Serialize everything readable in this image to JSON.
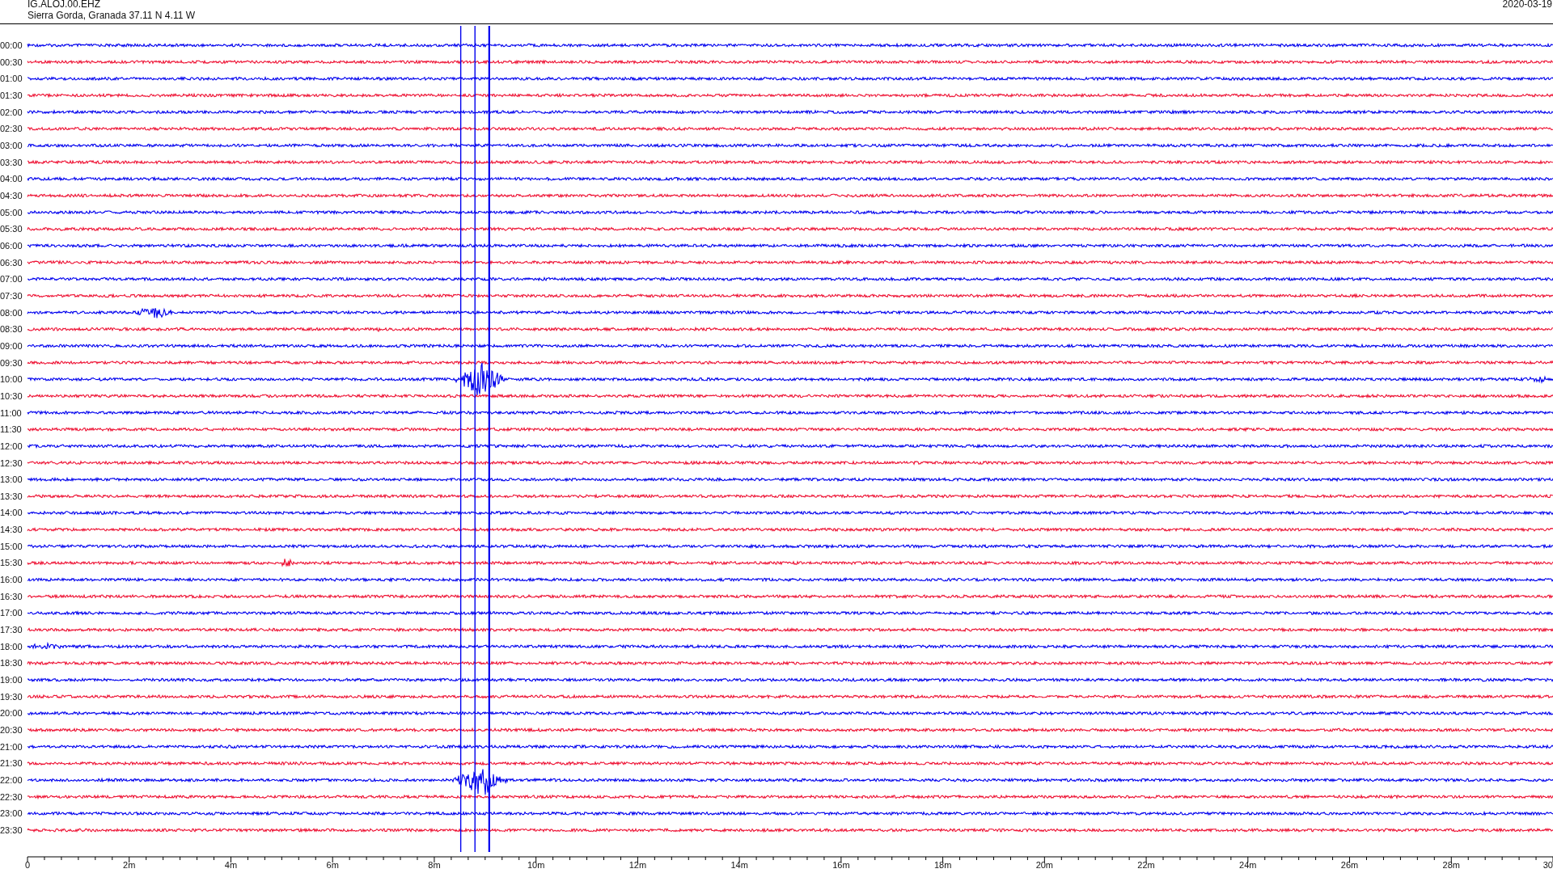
{
  "header": {
    "station": "IG.ALOJ.00.EHZ",
    "location": "Sierra Gorda, Granada  37.11 N 4.11 W",
    "date": "2020-03-19"
  },
  "traces": [
    {
      "time": "00:00",
      "color": "#0000ee"
    },
    {
      "time": "00:30",
      "color": "#ee1133"
    },
    {
      "time": "01:00",
      "color": "#0000ee"
    },
    {
      "time": "01:30",
      "color": "#ee1133"
    },
    {
      "time": "02:00",
      "color": "#0000ee"
    },
    {
      "time": "02:30",
      "color": "#ee1133"
    },
    {
      "time": "03:00",
      "color": "#0000ee"
    },
    {
      "time": "03:30",
      "color": "#ee1133"
    },
    {
      "time": "04:00",
      "color": "#0000ee"
    },
    {
      "time": "04:30",
      "color": "#ee1133"
    },
    {
      "time": "05:00",
      "color": "#0000ee"
    },
    {
      "time": "05:30",
      "color": "#ee1133"
    },
    {
      "time": "06:00",
      "color": "#0000ee"
    },
    {
      "time": "06:30",
      "color": "#ee1133"
    },
    {
      "time": "07:00",
      "color": "#0000ee"
    },
    {
      "time": "07:30",
      "color": "#ee1133"
    },
    {
      "time": "08:00",
      "color": "#0000ee"
    },
    {
      "time": "08:30",
      "color": "#ee1133"
    },
    {
      "time": "09:00",
      "color": "#0000ee"
    },
    {
      "time": "09:30",
      "color": "#ee1133"
    },
    {
      "time": "10:00",
      "color": "#0000ee"
    },
    {
      "time": "10:30",
      "color": "#ee1133"
    },
    {
      "time": "11:00",
      "color": "#0000ee"
    },
    {
      "time": "11:30",
      "color": "#ee1133"
    },
    {
      "time": "12:00",
      "color": "#0000ee"
    },
    {
      "time": "12:30",
      "color": "#ee1133"
    },
    {
      "time": "13:00",
      "color": "#0000ee"
    },
    {
      "time": "13:30",
      "color": "#ee1133"
    },
    {
      "time": "14:00",
      "color": "#0000ee"
    },
    {
      "time": "14:30",
      "color": "#ee1133"
    },
    {
      "time": "15:00",
      "color": "#0000ee"
    },
    {
      "time": "15:30",
      "color": "#ee1133"
    },
    {
      "time": "16:00",
      "color": "#0000ee"
    },
    {
      "time": "16:30",
      "color": "#ee1133"
    },
    {
      "time": "17:00",
      "color": "#0000ee"
    },
    {
      "time": "17:30",
      "color": "#ee1133"
    },
    {
      "time": "18:00",
      "color": "#0000ee"
    },
    {
      "time": "18:30",
      "color": "#ee1133"
    },
    {
      "time": "19:00",
      "color": "#0000ee"
    },
    {
      "time": "19:30",
      "color": "#ee1133"
    },
    {
      "time": "20:00",
      "color": "#0000ee"
    },
    {
      "time": "20:30",
      "color": "#ee1133"
    },
    {
      "time": "21:00",
      "color": "#0000ee"
    },
    {
      "time": "21:30",
      "color": "#ee1133"
    },
    {
      "time": "22:00",
      "color": "#0000ee"
    },
    {
      "time": "22:30",
      "color": "#ee1133"
    },
    {
      "time": "23:00",
      "color": "#0000ee"
    },
    {
      "time": "23:30",
      "color": "#ee1133"
    }
  ],
  "x_axis": {
    "ticks": [
      "0",
      "2m",
      "4m",
      "6m",
      "8m",
      "10m",
      "12m",
      "14m",
      "16m",
      "18m",
      "20m",
      "22m",
      "24m",
      "26m",
      "28m",
      "30"
    ]
  }
}
